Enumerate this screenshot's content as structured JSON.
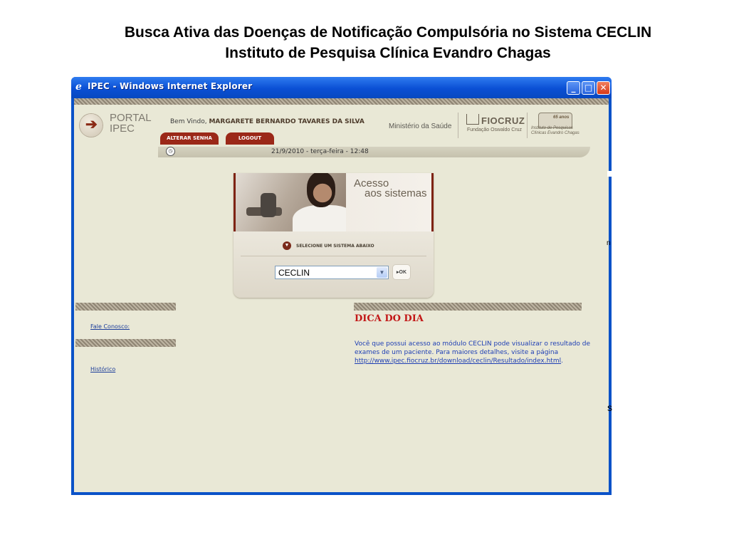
{
  "slide": {
    "title_line1": "Busca Ativa das Doenças de Notificação Compulsória no Sistema CECLIN",
    "title_line2": "Instituto de Pesquisa Clínica Evandro Chagas"
  },
  "window": {
    "title": "IPEC - Windows Internet Explorer",
    "buttons": {
      "minimize": "_",
      "maximize": "□",
      "close": "✕"
    }
  },
  "portal": {
    "name_line1": "PORTAL",
    "name_line2": "IPEC",
    "welcome_prefix": "Bem Vindo,",
    "user_name": "MARGARETE BERNARDO TAVARES DA SILVA",
    "tabs": [
      "ALTERAR SENHA",
      "LOGOUT"
    ],
    "ministerio": "Ministério da Saúde",
    "fiocruz": "FIOCRUZ",
    "fiocruz_sub": "Fundação Oswaldo Cruz",
    "ipec_badge": "65 anos",
    "ipec_sub": "Instituto de Pesquisas Clínicas Evandro Chagas",
    "datetime": "21/9/2010 - terça-feira - 12:48"
  },
  "access": {
    "heading_line1": "Acesso",
    "heading_line2": "aos sistemas",
    "instruction": "SELECIONE UM SISTEMA ABAIXO",
    "selected_system": "CECLIN",
    "ok_label": "▸OK"
  },
  "sidebar": {
    "links": [
      "Fale Conosco:",
      "Histórico"
    ]
  },
  "dica": {
    "title": "DICA DO DIA",
    "text": "Você que possui acesso ao módulo CECLIN pode visualizar o resultado de exames de um paciente. Para maiores detalhes, visite a página",
    "link": "http://www.ipec.fiocruz.br/download/ceclin/Resultado/index.html",
    "suffix": "."
  },
  "background_fragments": {
    "f1": "n",
    "f2": "s"
  },
  "colors": {
    "titlebar": "#0a52c8",
    "content_bg": "#e9e8d6",
    "accent": "#9b2818",
    "dica_title": "#c21818",
    "link": "#1f3fb4"
  }
}
